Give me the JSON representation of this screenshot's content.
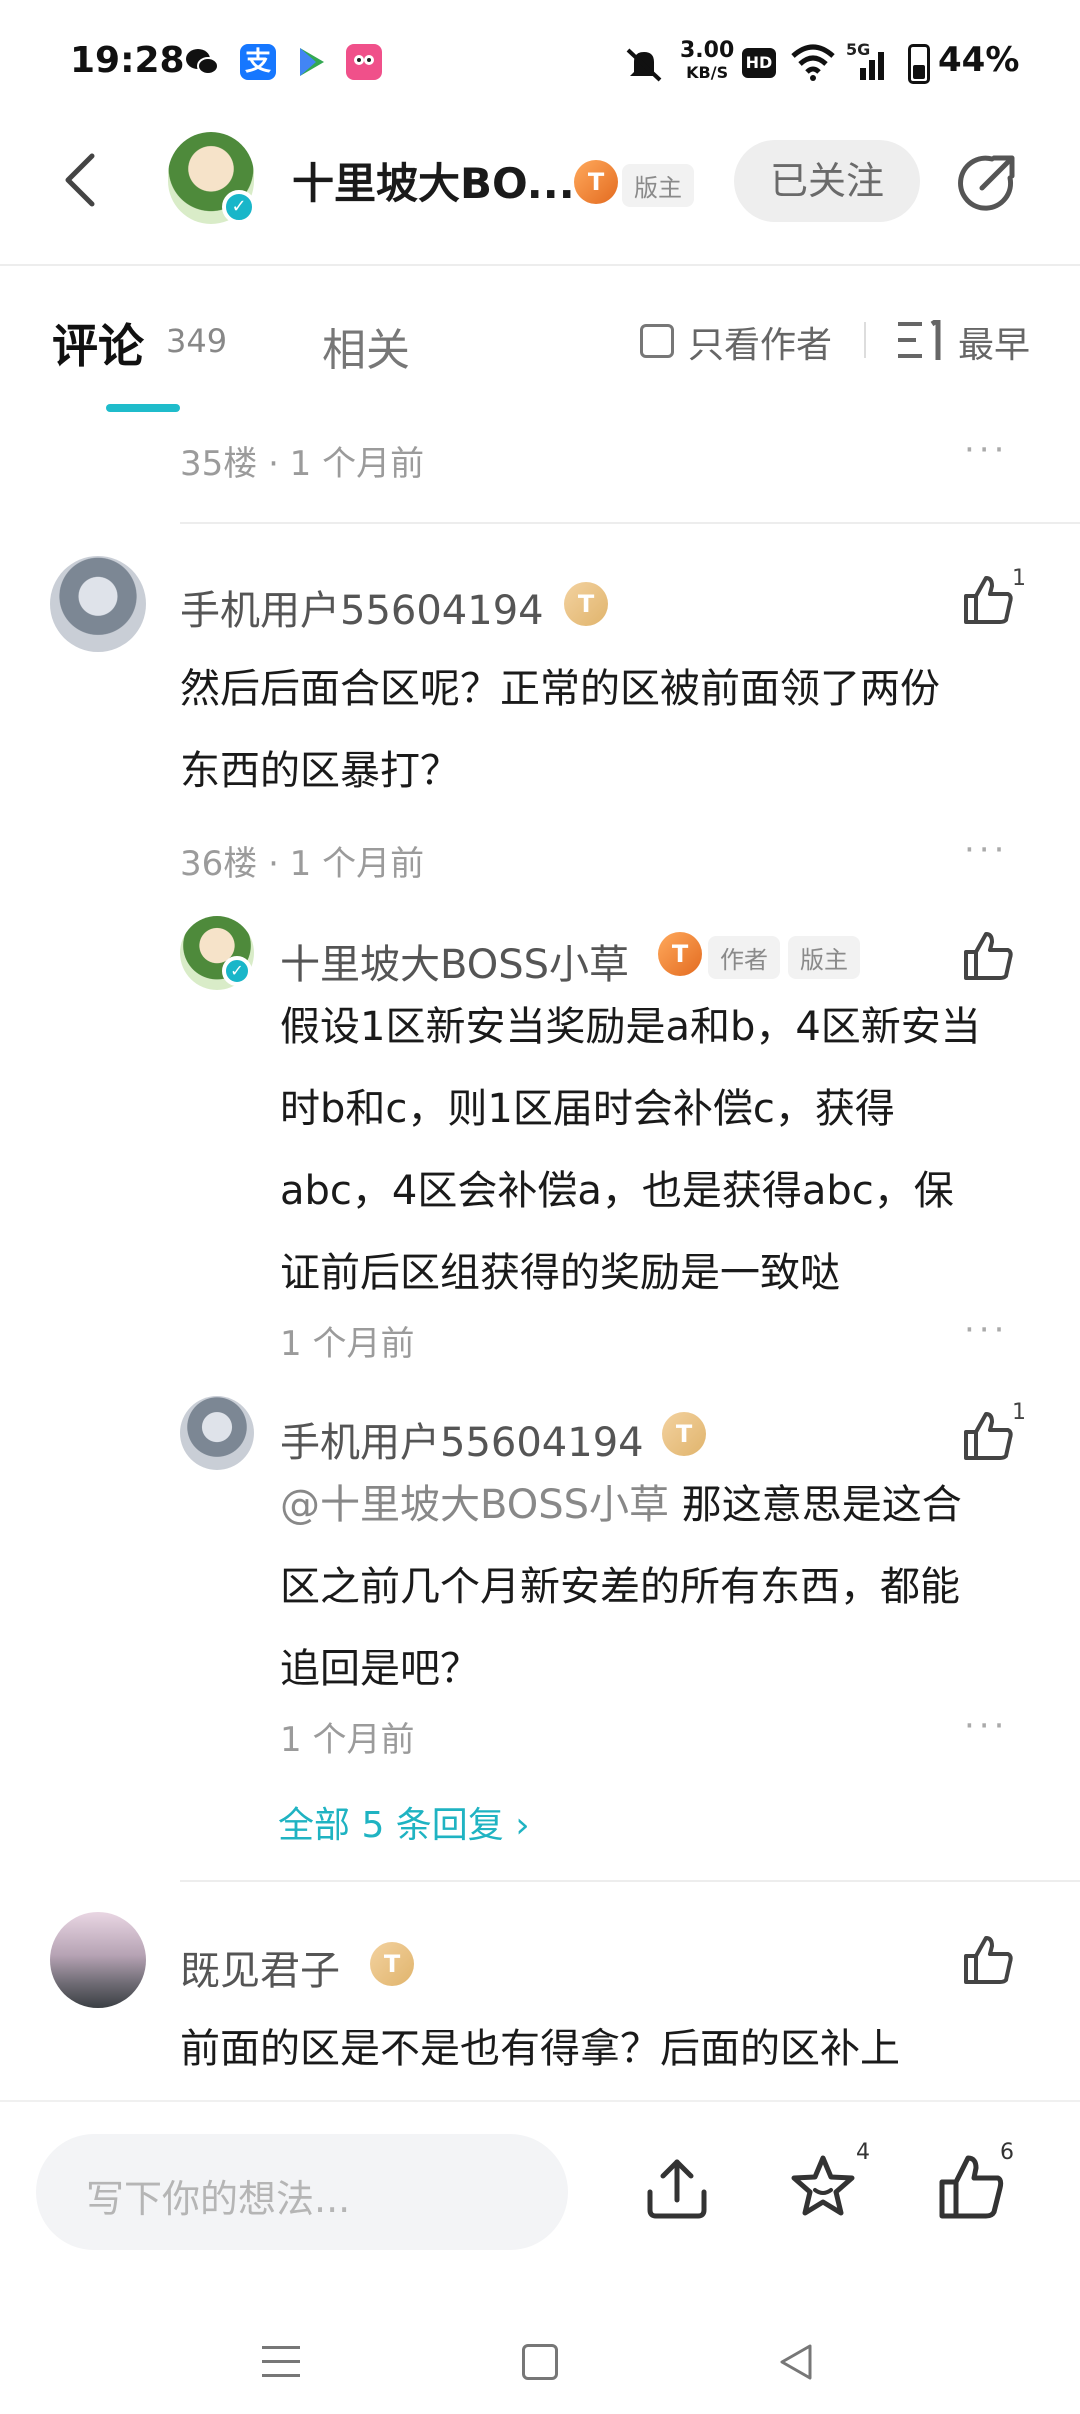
{
  "status_bar": {
    "time": "19:28",
    "speed": "3.00",
    "speed_unit": "KB/S",
    "hd": "HD",
    "network": "5G",
    "battery": "44%"
  },
  "header": {
    "title": "十里坡大BO...",
    "level": "T",
    "role": "版主",
    "follow_label": "已关注"
  },
  "tabs": {
    "comments_label": "评论",
    "comments_count": "349",
    "related_label": "相关",
    "only_author_label": "只看作者",
    "sort_label": "最早"
  },
  "comments": [
    {
      "floor_meta": "35楼 · 1 个月前"
    },
    {
      "username": "手机用户55604194",
      "level": "T",
      "text_line1": "然后后面合区呢？正常的区被前面领了两份",
      "text_line2": "东西的区暴打？",
      "likes": "1",
      "floor_meta": "36楼 · 1 个月前",
      "replies": [
        {
          "username": "十里坡大BOSS小草",
          "level": "T",
          "tag_author": "作者",
          "tag_role": "版主",
          "line1": "假设1区新安当奖励是a和b，4区新安当",
          "line2": "时b和c，则1区届时会补偿c，获得",
          "line3": "abc，4区会补偿a，也是获得abc，保",
          "line4": "证前后区组获得的奖励是一致哒",
          "meta": "1 个月前"
        },
        {
          "username": "手机用户55604194",
          "level": "T",
          "likes": "1",
          "mention": "@十里坡大BOSS小草",
          "line1": " 那这意思是这合",
          "line2": "区之前几个月新安差的所有东西，都能",
          "line3": "追回是吧？",
          "meta": "1 个月前"
        }
      ],
      "all_replies": "全部 5 条回复 ›"
    },
    {
      "username": "既见君子",
      "level": "T",
      "text_line1": "前面的区是不是也有得拿？后面的区补上"
    }
  ],
  "bottom_bar": {
    "input_placeholder": "写下你的想法...",
    "favorite_count": "4",
    "like_count": "6"
  },
  "colors": {
    "accent": "#1fbccb",
    "badge": "#e8762a"
  }
}
